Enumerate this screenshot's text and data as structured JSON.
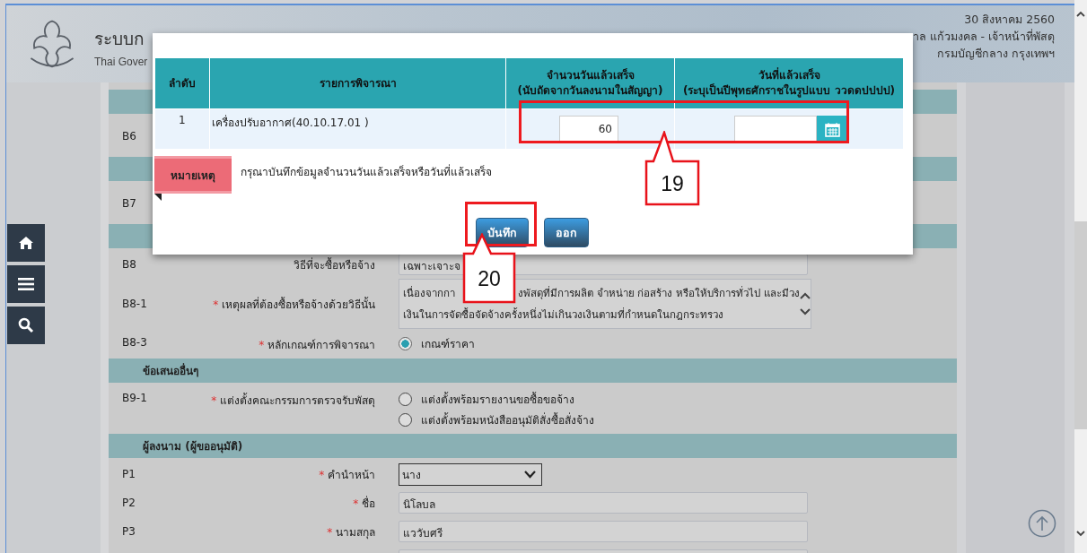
{
  "header": {
    "title": "ระบบก",
    "subtitle": "Thai Gover",
    "date": "30 สิงหาคม 2560",
    "user": "าล แก้วมงคล - เจ้าหน้าที่พัสดุ",
    "department": "กรมบัญชีกลาง กรุงเทพฯ"
  },
  "sidebar_buttons": [
    {
      "kind": "home"
    },
    {
      "kind": "menu"
    },
    {
      "kind": "search"
    }
  ],
  "form_rows": [
    {
      "kind": "section"
    },
    {
      "kind": "code",
      "code": "B6"
    },
    {
      "kind": "section"
    },
    {
      "kind": "code",
      "code": "B7"
    },
    {
      "kind": "section"
    },
    {
      "kind": "field",
      "code": "B8",
      "label": "วิธีที่จะซื้อหรือจ้าง",
      "value": "เฉพาะเจาะจ"
    },
    {
      "kind": "textarea",
      "code": "B8-1",
      "label": "เหตุผลที่ต้องซื้อหรือจ้างด้วยวิธีนั้น",
      "required_mark": "*",
      "line_1_start": "เนื่องจากกา",
      "line_1_end": "งพัสดุที่มีการผลิต จำหน่าย ก่อสร้าง หรือให้บริการทั่วไป และมีวง",
      "line_2": "เงินในการจัดซื้อจัดจ้างครั้งหนึ่งไม่เกินวงเงินตามที่กำหนดในกฎกระทรวง"
    },
    {
      "kind": "radio",
      "code": "B8-3",
      "label": "หลักเกณฑ์การพิจารณา",
      "required_mark": "*",
      "options": [
        {
          "label": "เกณฑ์ราคา",
          "selected": true
        }
      ]
    },
    {
      "kind": "section",
      "label": "ข้อเสนออื่นๆ"
    },
    {
      "kind": "radio",
      "code": "B9-1",
      "label": "แต่งตั้งคณะกรรมการตรวจรับพัสดุ",
      "required_mark": "*",
      "options": [
        {
          "label": "แต่งตั้งพร้อมรายงานขอซื้อขอจ้าง",
          "selected": false
        },
        {
          "label": "แต่งตั้งพร้อมหนังสืออนุมัติสั่งซื้อสั่งจ้าง",
          "selected": false
        }
      ]
    },
    {
      "kind": "section",
      "label": "ผู้ลงนาม (ผู้ขออนุมัติ)"
    },
    {
      "kind": "select",
      "code": "P1",
      "label": "คำนำหน้า",
      "required_mark": "*",
      "value": "นาง"
    },
    {
      "kind": "field",
      "code": "P2",
      "label": "ชื่อ",
      "required_mark": "*",
      "value": "นิโลบล"
    },
    {
      "kind": "field",
      "code": "P3",
      "label": "นามสกุล",
      "required_mark": "*",
      "value": "แววับศรี"
    },
    {
      "kind": "field"
    }
  ],
  "dialog": {
    "columns": [
      {
        "lines": [
          "ลำดับ"
        ]
      },
      {
        "lines": [
          "รายการพิจารณา"
        ]
      },
      {
        "lines": [
          "จำนวนวันแล้วเสร็จ",
          "(นับถัดจากวันลงนามในสัญญา)"
        ]
      },
      {
        "lines": [
          "วันที่แล้วเสร็จ",
          "(ระบุเป็นปีพุทธศักราชในรูปแบบ ววดดปปปป)"
        ]
      }
    ],
    "rows": [
      {
        "number": "1",
        "item": "เครื่องปรับอากาศ(40.10.17.01 )",
        "days": "60"
      }
    ],
    "note_tag": "หมายเหตุ",
    "note": "กรุณาบันทึกข้อมูลจำนวนวันแล้วเสร็จหรือวันที่แล้วเสร็จ",
    "buttons": [
      {
        "label": "บันทึก"
      },
      {
        "label": "ออก"
      }
    ]
  },
  "annotations": [
    {
      "label": "19"
    },
    {
      "label": "20"
    }
  ]
}
